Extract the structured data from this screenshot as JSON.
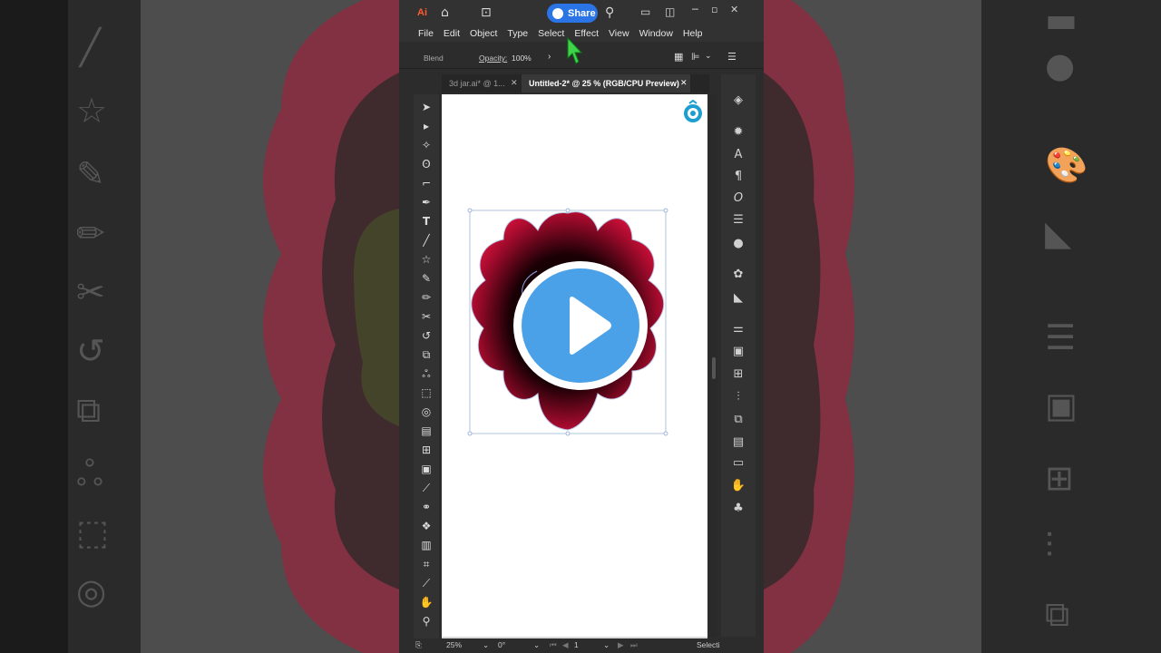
{
  "app": {
    "logo": "Ai",
    "share_label": "Share",
    "menu": [
      "File",
      "Edit",
      "Object",
      "Type",
      "Select",
      "Effect",
      "View",
      "Window",
      "Help"
    ],
    "control_bar": {
      "mode_label": "Blend",
      "opacity_label": "Opacity:",
      "opacity_value": "100%"
    },
    "tabs": [
      {
        "label": "3d jar.ai* @ 1...",
        "active": false
      },
      {
        "label": "Untitled-2* @ 25 % (RGB/CPU Preview)",
        "active": true
      }
    ],
    "status": {
      "zoom": "25%",
      "rotation": "0°",
      "artboard_number": "1",
      "tool_label": "Selecti"
    }
  },
  "colors": {
    "accent_blue": "#2a74e6",
    "play_blue": "#4ba1e8",
    "flower_red": "#d0103a",
    "flower_dark": "#1a0005",
    "ui_dark": "#2c2c2c"
  },
  "icons": {
    "tools": [
      "selection-icon",
      "direct-selection-icon",
      "magic-wand-icon",
      "lasso-icon",
      "curvature-icon",
      "pen-icon",
      "type-icon",
      "line-icon",
      "star-icon",
      "paintbrush-icon",
      "pencil-icon",
      "scissors-icon",
      "rotate-icon",
      "scale-icon",
      "warp-icon",
      "free-transform-icon",
      "shape-builder-icon",
      "perspective-icon",
      "mesh-icon",
      "gradient-icon",
      "eyedropper-icon",
      "blend-icon",
      "symbol-sprayer-icon",
      "column-graph-icon",
      "artboard-icon",
      "slice-icon",
      "hand-icon",
      "zoom-icon"
    ],
    "panels": [
      "layers-icon",
      "appearance-icon",
      "character-icon",
      "paragraph-icon",
      "opentype-icon",
      "stroke-icon",
      "transparency-icon",
      "color-guide-icon",
      "swatches-icon",
      "libraries-icon",
      "properties-icon",
      "artboards-icon",
      "transform-icon",
      "align-icon",
      "pathfinder-icon",
      "gradient-panel-icon",
      "image-trace-icon",
      "puppet-icon",
      "symbols-icon"
    ]
  }
}
